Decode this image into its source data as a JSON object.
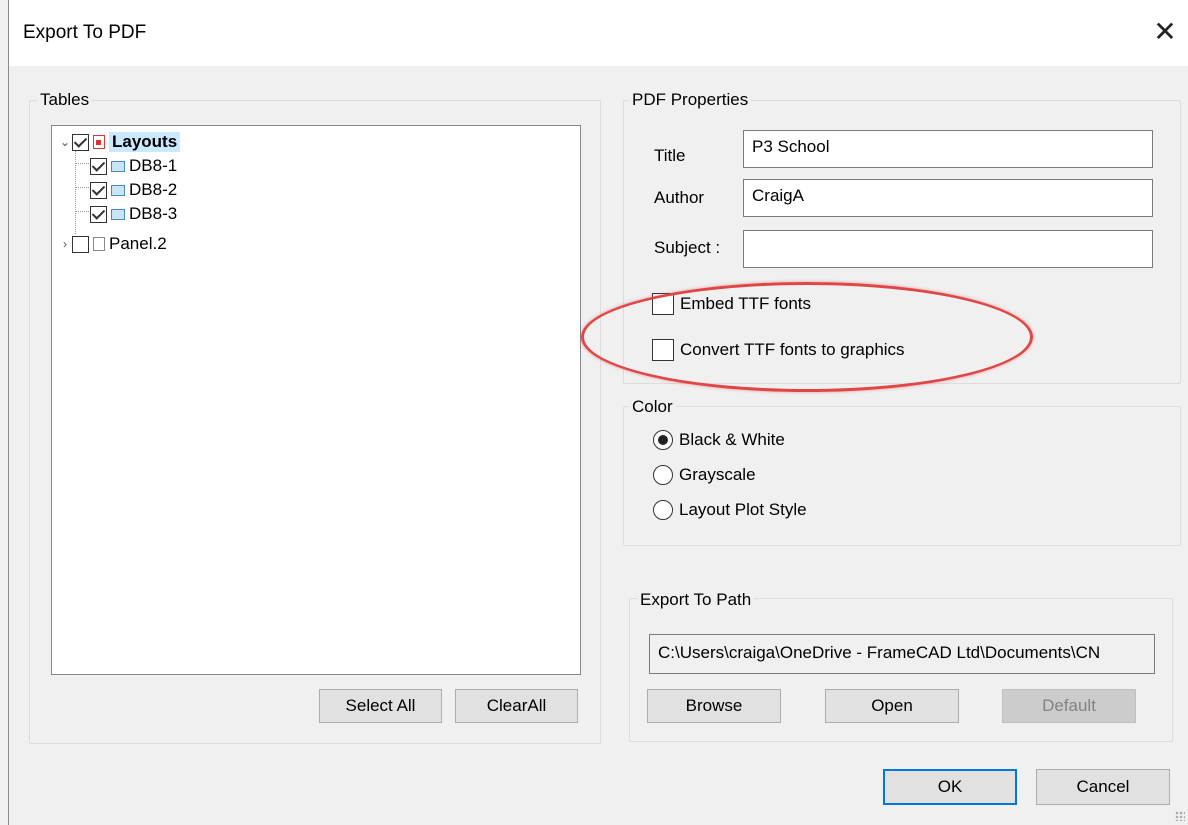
{
  "window": {
    "title": "Export To PDF",
    "close_glyph": "✕"
  },
  "tables": {
    "legend": "Tables",
    "tree": [
      {
        "label": "Layouts",
        "checked": true,
        "expanded": true,
        "icon": "layout-red-icon"
      },
      {
        "label": "DB8-1",
        "checked": true,
        "icon": "sheet-icon"
      },
      {
        "label": "DB8-2",
        "checked": true,
        "icon": "sheet-icon"
      },
      {
        "label": "DB8-3",
        "checked": true,
        "icon": "sheet-icon"
      },
      {
        "label": "Panel.2",
        "checked": false,
        "expanded": false,
        "icon": "page-icon"
      }
    ],
    "select_all_label": "Select All",
    "clear_all_label": "ClearAll"
  },
  "pdf_properties": {
    "legend": "PDF Properties",
    "title_label": "Title",
    "title_value": "P3 School",
    "author_label": "Author",
    "author_value": "CraigA",
    "subject_label": "Subject :",
    "subject_value": "",
    "embed_ttf_label": "Embed TTF fonts",
    "embed_ttf_checked": false,
    "convert_ttf_label": "Convert TTF fonts to graphics",
    "convert_ttf_checked": false
  },
  "color": {
    "legend": "Color",
    "options": [
      {
        "label": "Black & White",
        "selected": true
      },
      {
        "label": "Grayscale",
        "selected": false
      },
      {
        "label": "Layout Plot Style",
        "selected": false
      }
    ]
  },
  "export_path": {
    "legend": "Export To Path",
    "path_value": "C:\\Users\\craiga\\OneDrive - FrameCAD Ltd\\Documents\\CN",
    "browse_label": "Browse",
    "open_label": "Open",
    "default_label": "Default"
  },
  "footer": {
    "ok_label": "OK",
    "cancel_label": "Cancel"
  },
  "colors": {
    "highlight_ellipse": "#e04646",
    "selection_bg": "#cce8ff",
    "default_button_border": "#0078d7"
  }
}
